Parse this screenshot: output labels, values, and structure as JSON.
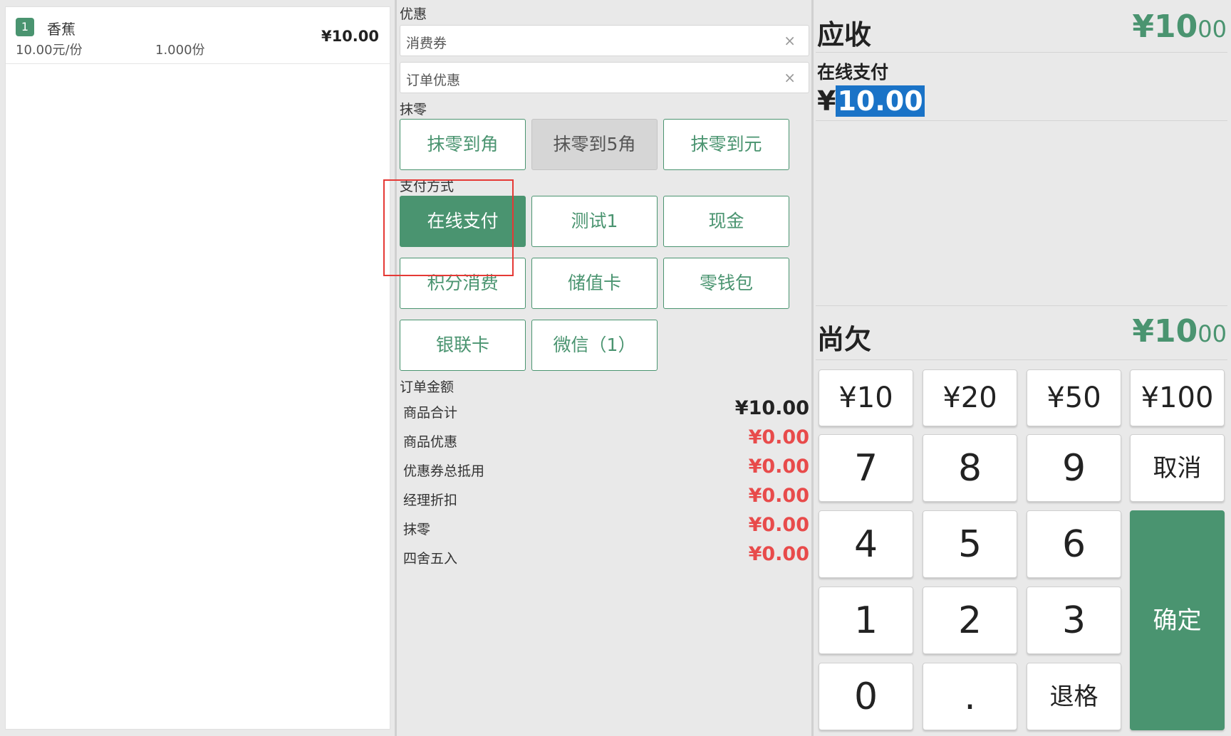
{
  "cart": {
    "items": [
      {
        "index": "1",
        "name": "香蕉",
        "unit_price": "10.00元/份",
        "quantity": "1.000份",
        "total": "¥10.00"
      }
    ]
  },
  "discount": {
    "section_label": "优惠",
    "coupon_placeholder": "消费券",
    "order_discount_placeholder": "订单优惠",
    "clear_symbol": "×"
  },
  "rounding": {
    "section_label": "抹零",
    "options": [
      "抹零到角",
      "抹零到5角",
      "抹零到元"
    ]
  },
  "payment": {
    "section_label": "支付方式",
    "methods": [
      "在线支付",
      "测试1",
      "现金",
      "积分消费",
      "储值卡",
      "零钱包",
      "银联卡",
      "微信（1）"
    ],
    "selected": "在线支付"
  },
  "order_amount": {
    "section_label": "订单金额",
    "rows": [
      {
        "label": "商品合计",
        "value": "¥10.00"
      },
      {
        "label": "商品优惠",
        "value": "¥0.00"
      },
      {
        "label": "优惠券总抵用",
        "value": "¥0.00"
      },
      {
        "label": "经理折扣",
        "value": "¥0.00"
      },
      {
        "label": "抹零",
        "value": "¥0.00"
      },
      {
        "label": "四舍五入",
        "value": "¥0.00"
      }
    ]
  },
  "summary": {
    "receivable_label": "应收",
    "receivable_yen": "¥",
    "receivable_int": "10",
    "receivable_cents": "00",
    "online_pay_label": "在线支付",
    "online_pay_currency": "¥",
    "online_pay_value": "10.00",
    "owed_label": "尚欠",
    "owed_yen": "¥",
    "owed_int": "10",
    "owed_cents": "00"
  },
  "keypad": {
    "quick_amounts": [
      "¥10",
      "¥20",
      "¥50",
      "¥100"
    ],
    "digits": [
      "7",
      "8",
      "9",
      "4",
      "5",
      "6",
      "1",
      "2",
      "3",
      "0",
      "."
    ],
    "cancel": "取消",
    "backspace": "退格",
    "confirm": "确定"
  },
  "colors": {
    "accent": "#4a9470",
    "negative": "#e84b4b",
    "highlight_box": "#e53935",
    "selection": "#1a73c7"
  }
}
